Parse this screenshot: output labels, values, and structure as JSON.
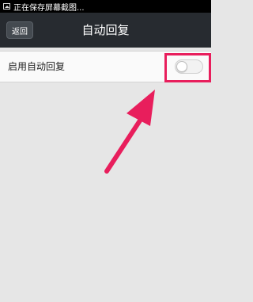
{
  "status_bar": {
    "notification_icon": "image-icon",
    "text": "正在保存屏幕截图..."
  },
  "header": {
    "back_label": "返回",
    "title": "自动回复"
  },
  "settings": {
    "auto_reply": {
      "label": "启用自动回复",
      "enabled": false
    }
  },
  "annotation": {
    "color": "#e81e5c",
    "arrow_icon": "arrow-up-right-icon"
  },
  "colors": {
    "titlebar": "#272b30",
    "background": "#e6e6e6"
  }
}
